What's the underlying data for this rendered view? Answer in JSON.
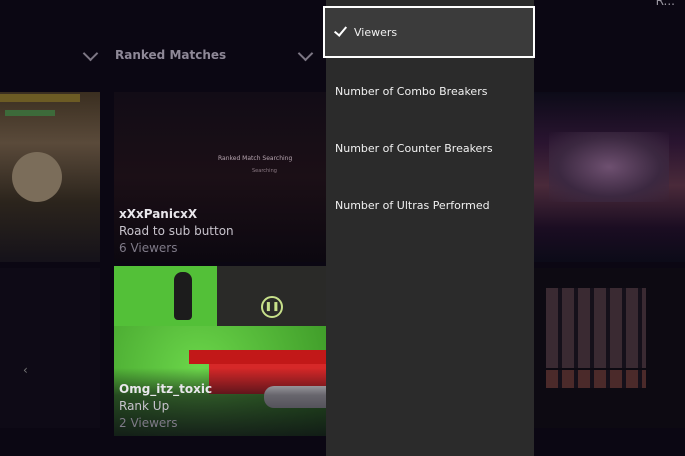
{
  "header": {
    "filter_label": "Ranked Matches",
    "corner_text": "R..."
  },
  "tiles": [
    {
      "name": "xXxPanicxX",
      "title": "Road to sub button",
      "viewers": "6 Viewers",
      "screen_text": "Ranked Match Searching",
      "screen_subtext": "Searching"
    },
    {
      "name": "Omg_itz_toxic",
      "title": "Rank Up",
      "viewers": "2 Viewers"
    }
  ],
  "dropdown": {
    "options": [
      {
        "label": "Viewers",
        "selected": true
      },
      {
        "label": "Number of Combo Breakers",
        "selected": false
      },
      {
        "label": "Number of Counter Breakers",
        "selected": false
      },
      {
        "label": "Number of Ultras Performed",
        "selected": false
      }
    ]
  },
  "colors": {
    "dropdown_bg": "#2b2b2b",
    "selected_bg": "#3b3b3b",
    "selection_border": "#ffffff",
    "green_tile": "#53c038"
  }
}
